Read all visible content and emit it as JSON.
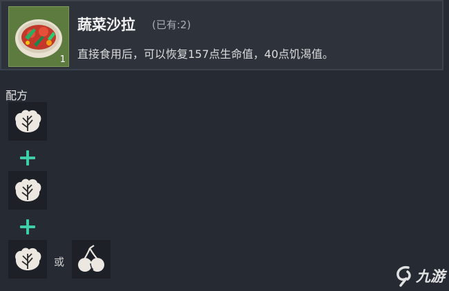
{
  "item": {
    "name": "蔬菜沙拉",
    "owned": "(已有:2)",
    "count": "1",
    "description": "直接食用后，可以恢复157点生命值，40点饥渴值。",
    "icon": "vegetable-salad-icon"
  },
  "recipe": {
    "label": "配方",
    "ingredients": [
      {
        "icon": "cabbage-leaf-icon"
      },
      {
        "icon": "cabbage-leaf-icon"
      },
      {
        "icon": "cabbage-leaf-icon",
        "alternative_icon": "cherry-icon"
      }
    ],
    "plus_symbol": "+",
    "or_text": "或"
  },
  "watermark": {
    "text": "九游",
    "icon": "jiuyou-logo-icon"
  },
  "colors": {
    "background": "#262b33",
    "header": "#2d323b",
    "item_slot": "#5d7a3f",
    "plus": "#3ecfa8"
  }
}
